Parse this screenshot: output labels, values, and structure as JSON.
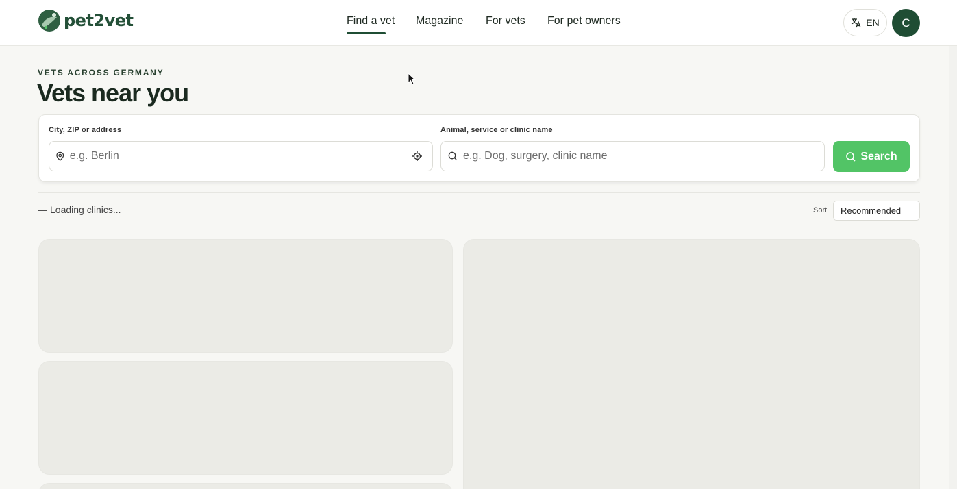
{
  "header": {
    "brand": "pet2vet",
    "nav": [
      {
        "label": "Find a vet",
        "active": true
      },
      {
        "label": "Magazine"
      },
      {
        "label": "For vets"
      },
      {
        "label": "For pet owners"
      }
    ],
    "language": "EN",
    "avatar_initial": "C"
  },
  "hero": {
    "eyebrow": "Vets across Germany",
    "title": "Vets near you"
  },
  "search": {
    "location_label": "City, ZIP or address",
    "location_placeholder": "e.g. Berlin",
    "query_label": "Animal, service or clinic name",
    "query_placeholder": "e.g. Dog, surgery, clinic name",
    "button_label": "Search"
  },
  "results": {
    "status_dash": "—",
    "status_text": "Loading clinics...",
    "sort_label": "Sort",
    "sort_value": "Recommended"
  },
  "colors": {
    "brand_dark": "#1f4d34",
    "accent_green": "#52c466",
    "skeleton": "#ebebe6"
  },
  "icons": {
    "language": "translate-icon",
    "location": "map-pin-icon",
    "locate": "crosshair-icon",
    "search": "search-icon"
  }
}
